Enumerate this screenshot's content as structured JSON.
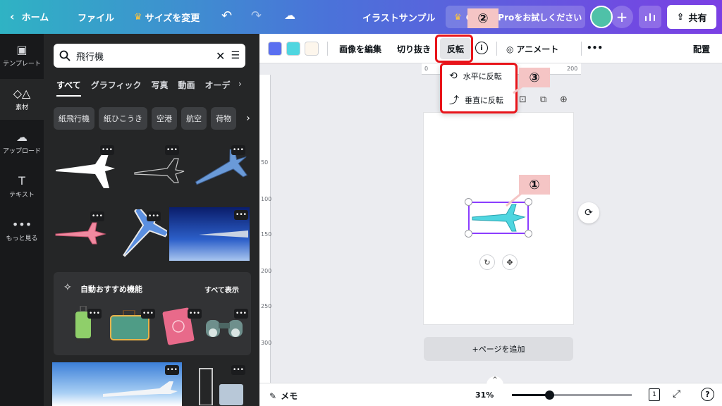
{
  "topbar": {
    "home": "ホーム",
    "file": "ファイル",
    "resize": "サイズを変更",
    "title": "イラストサンプル",
    "pro": "Canva Proをお試しください",
    "share": "共有"
  },
  "rail": {
    "items": [
      {
        "label": "テンプレート",
        "icon": "layout-icon"
      },
      {
        "label": "素材",
        "icon": "elements-icon"
      },
      {
        "label": "アップロード",
        "icon": "upload-icon"
      },
      {
        "label": "テキスト",
        "icon": "text-icon"
      },
      {
        "label": "もっと見る",
        "icon": "more-icon"
      }
    ]
  },
  "panel": {
    "search_value": "飛行機",
    "tabs": [
      "すべて",
      "グラフィック",
      "写真",
      "動画",
      "オーデ"
    ],
    "chips": [
      "紙飛行機",
      "紙ひこうき",
      "空港",
      "航空",
      "荷物"
    ],
    "reco_title": "自動おすすめ機能",
    "reco_all": "すべて表示",
    "more_dots": "•••"
  },
  "toolbar": {
    "edit_image": "画像を編集",
    "crop": "切り抜き",
    "flip": "反転",
    "animate": "アニメート",
    "more": "•••",
    "position": "配置",
    "swatches": [
      "#5a6ff0",
      "#4fd6e0",
      "#fdf6ec"
    ]
  },
  "flip_menu": {
    "horizontal": "水平に反転",
    "vertical": "垂直に反転"
  },
  "ruler": {
    "top": [
      "0",
      "100",
      "200"
    ],
    "left": [
      "50",
      "100",
      "150",
      "200",
      "250",
      "300"
    ]
  },
  "canvas": {
    "add_page": "+ページを追加"
  },
  "annotations": {
    "one": "①",
    "two": "②",
    "three": "③"
  },
  "bottombar": {
    "memo": "メモ",
    "zoom": "31%",
    "zoom_level": 0.31,
    "page_count": "1"
  }
}
